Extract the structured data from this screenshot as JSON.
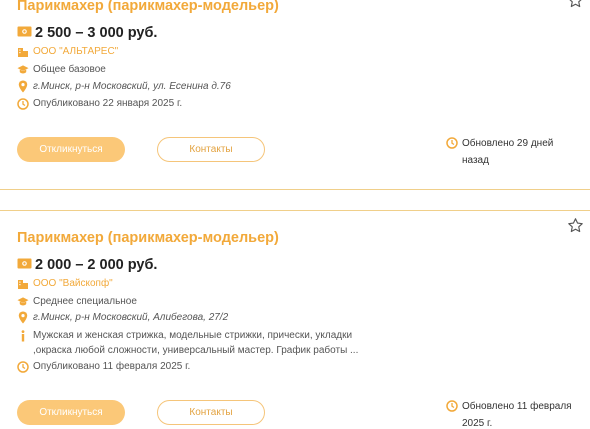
{
  "vacancies": [
    {
      "title": "Парикмахер (парикмахер-модельер)",
      "salary": "2 500 – 3 000 руб.",
      "company": "ООО \"АЛЬТАРЕС\"",
      "education": "Общее базовое",
      "address": "г.Минск, р-н Московский, ул. Есенина д.76",
      "published": "Опубликовано 22 января 2025 г.",
      "apply_label": "Откликнуться",
      "contacts_label": "Контакты",
      "updated": "Обновлено 29 дней назад"
    },
    {
      "title": "Парикмахер (парикмахер-модельер)",
      "salary": "2 000 – 2 000 руб.",
      "company": "ООО \"Вайскопф\"",
      "education": "Среднее специальное",
      "address": "г.Минск, р-н Московский, Алибегова, 27/2",
      "description": "Мужская и женская стрижка, модельные стрижки, прически, укладки ,окраска любой сложности, универсальный мастер. График работы ...",
      "published": "Опубликовано 11 февраля 2025 г.",
      "apply_label": "Откликнуться",
      "contacts_label": "Контакты",
      "updated": "Обновлено 11 февраля 2025 г."
    }
  ],
  "colors": {
    "accent": "#f2a93a",
    "button": "#fbc878",
    "divider": "#f0cf8a"
  },
  "icons": [
    "money-icon",
    "building-icon",
    "graduation-cap-icon",
    "map-pin-icon",
    "clock-icon",
    "info-icon",
    "star-icon"
  ]
}
